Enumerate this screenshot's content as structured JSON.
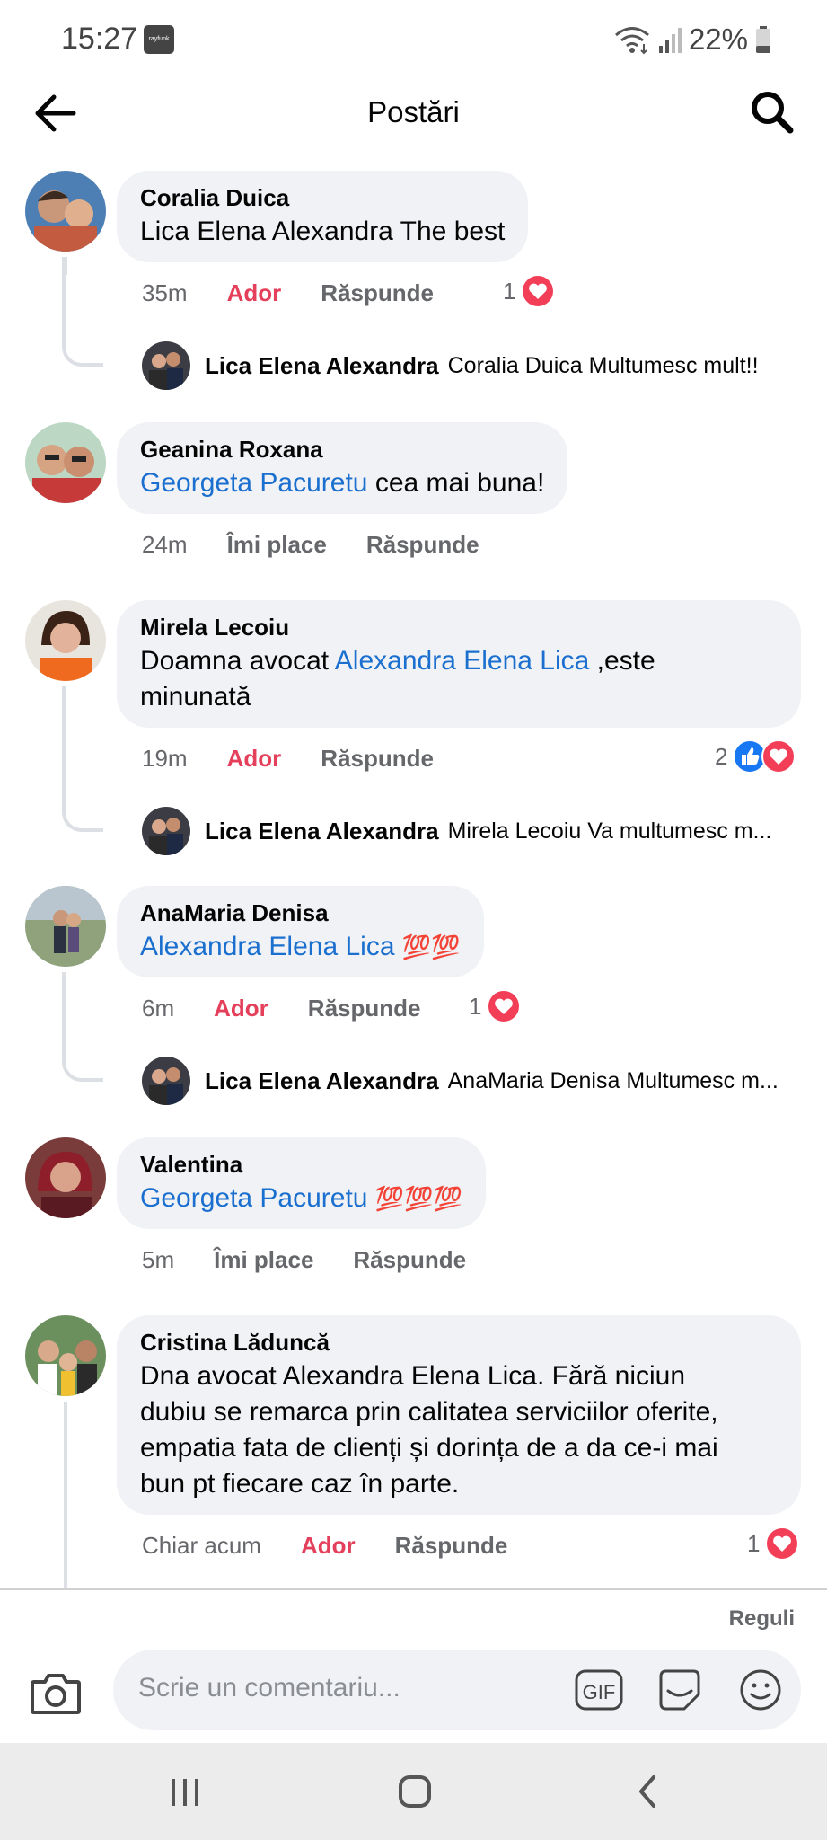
{
  "status": {
    "time": "15:27",
    "app_badge": "rayfunk",
    "battery": "22%"
  },
  "header": {
    "title": "Postări"
  },
  "comments": [
    {
      "name": "Coralia Duica",
      "text_parts": [
        "Lica Elena Alexandra The best"
      ],
      "time": "35m",
      "like_label": "Ador",
      "reply_label": "Răspunde",
      "reaction_count": "1",
      "replies": [
        {
          "name": "Lica Elena Alexandra",
          "text": "Coralia Duica Multumesc mult!!"
        }
      ]
    },
    {
      "name": "Geanina Roxana",
      "mention": "Georgeta Pacuretu",
      "text": " cea mai buna!",
      "time": "24m",
      "like_label": "Îmi place",
      "reply_label": "Răspunde"
    },
    {
      "name": "Mirela Lecoiu",
      "text_before": "Doamna avocat ",
      "mention": "Alexandra Elena Lica",
      "text_after": " ,este",
      "text_line2": "minunată",
      "time": "19m",
      "like_label": "Ador",
      "reply_label": "Răspunde",
      "reaction_count": "2",
      "replies": [
        {
          "name": "Lica Elena Alexandra",
          "text": "Mirela Lecoiu Va multumesc m..."
        }
      ]
    },
    {
      "name": "AnaMaria Denisa",
      "mention": "Alexandra Elena Lica",
      "emoji": "💯💯",
      "time": "6m",
      "like_label": "Ador",
      "reply_label": "Răspunde",
      "reaction_count": "1",
      "replies": [
        {
          "name": "Lica Elena Alexandra",
          "text": "AnaMaria Denisa Multumesc m..."
        }
      ]
    },
    {
      "name": "Valentina",
      "mention": "Georgeta Pacuretu",
      "emoji": "💯💯💯",
      "time": "5m",
      "like_label": "Îmi place",
      "reply_label": "Răspunde"
    },
    {
      "name": "Cristina Lăduncă",
      "lines": [
        "Dna avocat Alexandra Elena Lica. Fără niciun",
        "dubiu se remarca prin calitatea serviciilor oferite,",
        "empatia fata de clienți și dorința de a da ce-i mai",
        "bun pt fiecare caz în parte."
      ],
      "time": "Chiar acum",
      "like_label": "Ador",
      "reply_label": "Răspunde",
      "reaction_count": "1"
    }
  ],
  "footer": {
    "rules_label": "Reguli"
  },
  "composer": {
    "placeholder": "Scrie un comentariu...",
    "gif_label": "GIF"
  },
  "colors": {
    "love": "#e4405b",
    "mention": "#1b6fcf",
    "bubble": "#f0f2f5",
    "like_blue": "#1877f2"
  }
}
